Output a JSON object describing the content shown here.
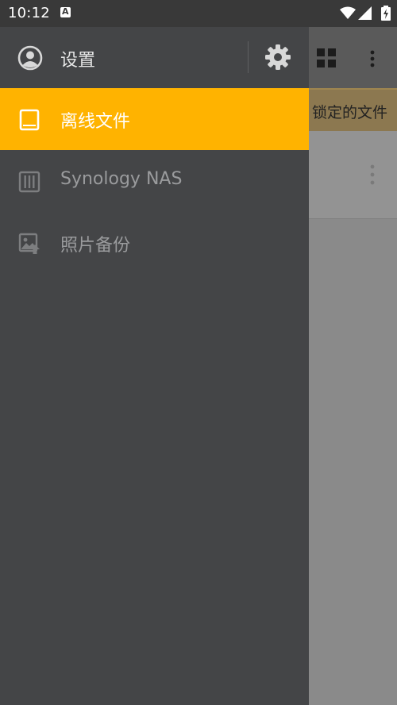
{
  "status_bar": {
    "time": "10:12"
  },
  "drawer": {
    "header": {
      "settings_label": "设置"
    },
    "items": [
      {
        "label": "离线文件",
        "icon": "tablet-icon",
        "active": true
      },
      {
        "label": "Synology NAS",
        "icon": "nas-icon",
        "active": false
      },
      {
        "label": "照片备份",
        "icon": "photo-backup-icon",
        "active": false
      }
    ],
    "accent_color": "#ffb300",
    "background_color": "#444547"
  },
  "background_page": {
    "banner_text": "锁定的文件"
  }
}
